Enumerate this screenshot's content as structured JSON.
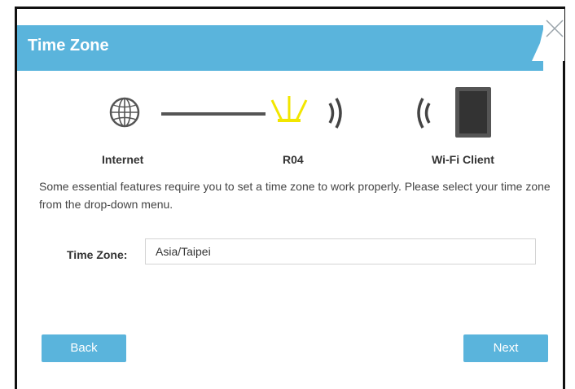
{
  "header": {
    "title": "Time Zone"
  },
  "topology": {
    "internet_label": "Internet",
    "router_label": "R04",
    "client_label": "Wi-Fi Client"
  },
  "description": "Some essential features require you to set a time zone to work properly. Please select your time zone from the drop-down menu.",
  "timezone": {
    "label": "Time Zone:",
    "value": "Asia/Taipei"
  },
  "buttons": {
    "back": "Back",
    "next": "Next"
  },
  "colors": {
    "accent": "#5ab4dc",
    "router": "#f2e600"
  },
  "icons": [
    "globe-icon",
    "router-icon",
    "wifi-signal-icon",
    "tablet-icon",
    "close-icon"
  ]
}
